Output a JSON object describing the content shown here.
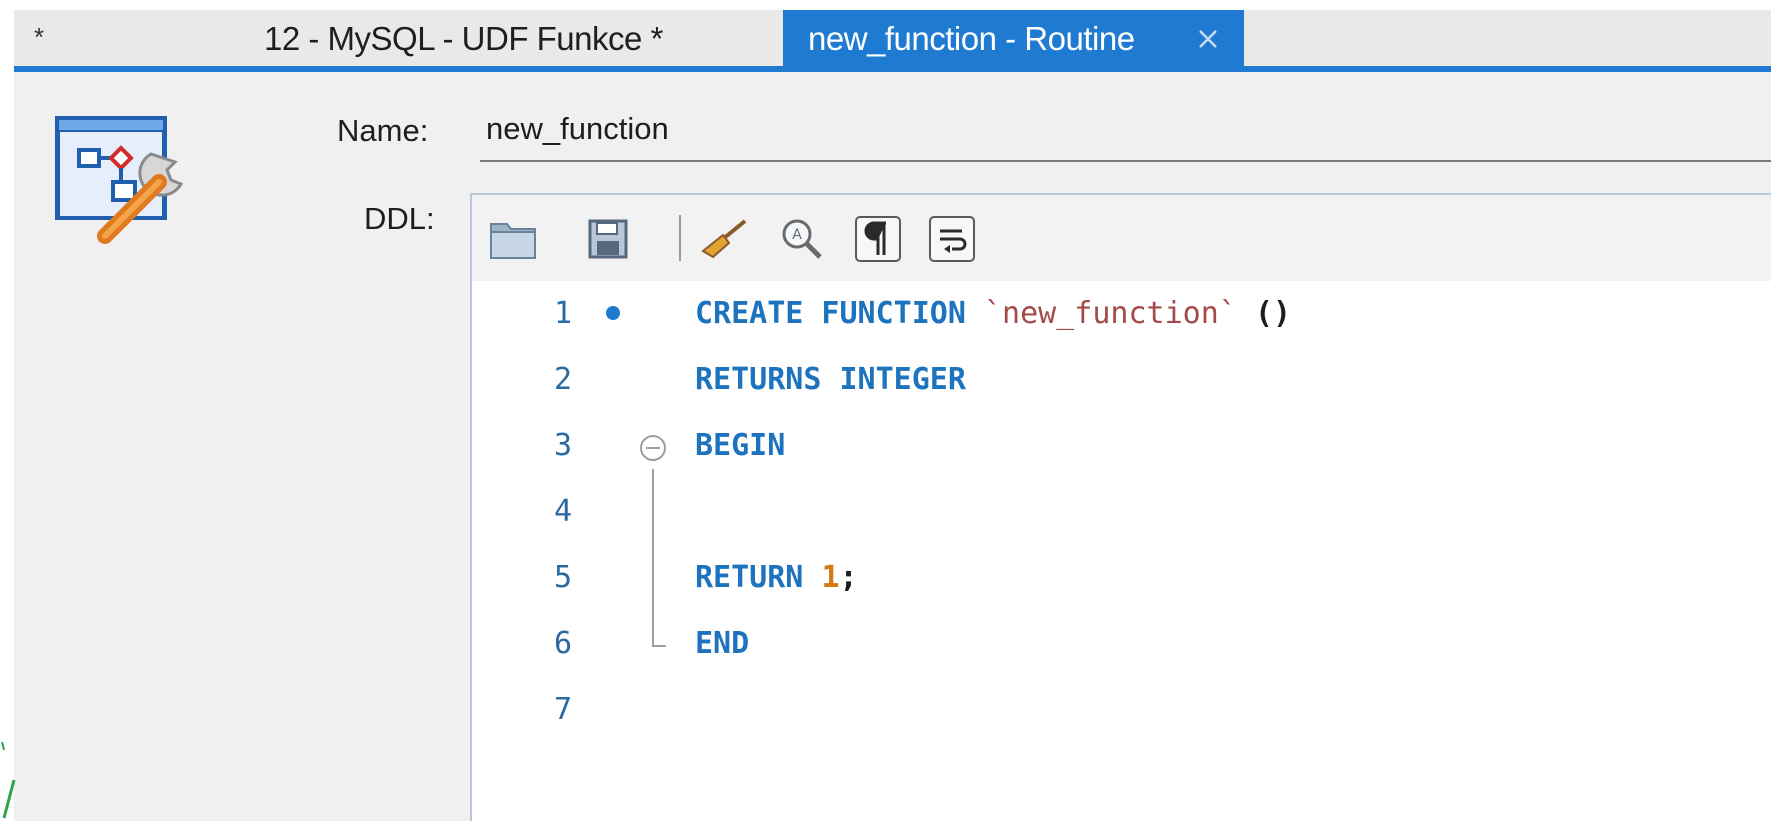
{
  "tabs": {
    "star": "*",
    "inactive_label": "12 - MySQL - UDF Funkce *",
    "active_label": "new_function - Routine"
  },
  "form": {
    "name_label": "Name:",
    "name_value": "new_function",
    "ddl_label": "DDL:"
  },
  "toolbar": {
    "icons": [
      "open-folder-icon",
      "save-icon",
      "beautify-broom-icon",
      "find-icon",
      "paragraph-icon",
      "word-wrap-icon"
    ]
  },
  "editor": {
    "line_numbers": [
      "1",
      "2",
      "3",
      "4",
      "5",
      "6",
      "7"
    ],
    "line1": {
      "kw": "CREATE FUNCTION",
      "str": "`new_function`",
      "punc": "()"
    },
    "line2": {
      "kw": "RETURNS INTEGER"
    },
    "line3": {
      "kw": "BEGIN"
    },
    "line5": {
      "kw": "RETURN",
      "num": "1",
      "punc": ";"
    },
    "line6": {
      "kw": "END"
    }
  },
  "colors": {
    "accent": "#1e7bd1",
    "keyword": "#1d73bd",
    "string": "#a44a4a",
    "number": "#d27b16"
  }
}
